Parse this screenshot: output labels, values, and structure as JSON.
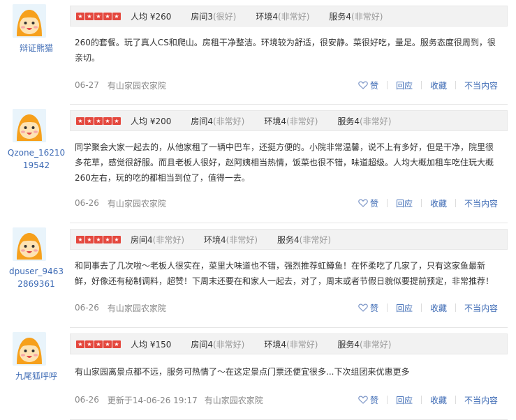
{
  "reviews": [
    {
      "username": "辩证熊猫",
      "stars": 5,
      "ratings": [
        {
          "text": "人均 ¥260",
          "sub": ""
        },
        {
          "text": "房间3",
          "sub": "(很好)"
        },
        {
          "text": "环境4",
          "sub": "(非常好)"
        },
        {
          "text": "服务4",
          "sub": "(非常好)"
        }
      ],
      "body": "260的套餐。玩了真人CS和爬山。房租干净整洁。环境较为舒适，很安静。菜很好吃，量足。服务态度很周到，很亲切。",
      "date": "06-27",
      "updated": "",
      "shop": "有山家园农家院"
    },
    {
      "username": "Qzone_1621019542",
      "stars": 5,
      "ratings": [
        {
          "text": "人均 ¥200",
          "sub": ""
        },
        {
          "text": "房间4",
          "sub": "(非常好)"
        },
        {
          "text": "环境4",
          "sub": "(非常好)"
        },
        {
          "text": "服务4",
          "sub": "(非常好)"
        }
      ],
      "body": "同学聚会大家一起去的，从他家租了一辆中巴车，还挺方便的。小院非常温馨，说不上有多好，但是干净，院里很多花草，感觉很舒服。而且老板人很好，赵阿姨相当热情，饭菜也很不错，味道超级。人均大概加租车吃住玩大概260左右，玩的吃的都相当到位了，值得一去。",
      "date": "06-26",
      "updated": "",
      "shop": "有山家园农家院"
    },
    {
      "username": "dpuser_94632869361",
      "stars": 5,
      "ratings": [
        {
          "text": "房间4",
          "sub": "(非常好)"
        },
        {
          "text": "环境4",
          "sub": "(非常好)"
        },
        {
          "text": "服务4",
          "sub": "(非常好)"
        }
      ],
      "body": "和同事去了几次啦～老板人很实在，菜里大味道也不错，强烈推荐虹鳟鱼！在怀柔吃了几家了，只有这家鱼最新鲜，好像还有秘制调料，超赞！下周末还要在和家人一起去，对了，周末或者节假日貌似要提前预定，非常推荐！",
      "date": "06-26",
      "updated": "",
      "shop": "有山家园农家院"
    },
    {
      "username": "九尾狐呼呼",
      "stars": 5,
      "ratings": [
        {
          "text": "人均 ¥150",
          "sub": ""
        },
        {
          "text": "房间4",
          "sub": "(非常好)"
        },
        {
          "text": "环境4",
          "sub": "(非常好)"
        },
        {
          "text": "服务4",
          "sub": "(非常好)"
        }
      ],
      "body": "有山家园离景点都不远，服务可热情了～在这定景点门票还便宜很多...下次组团来优惠更多",
      "date": "06-26",
      "updated": "更新于14-06-26 19:17",
      "shop": "有山家园农家院"
    }
  ],
  "actions": {
    "like": "赞",
    "reply": "回应",
    "favorite": "收藏",
    "report": "不当内容"
  },
  "colors": {
    "star": "#e4473d",
    "link": "#3e6bb5",
    "rating_bar_bg": "#f2f2f2"
  },
  "icons": {
    "like": "heart-outline-icon",
    "avatar": "cartoon-face-avatar"
  }
}
